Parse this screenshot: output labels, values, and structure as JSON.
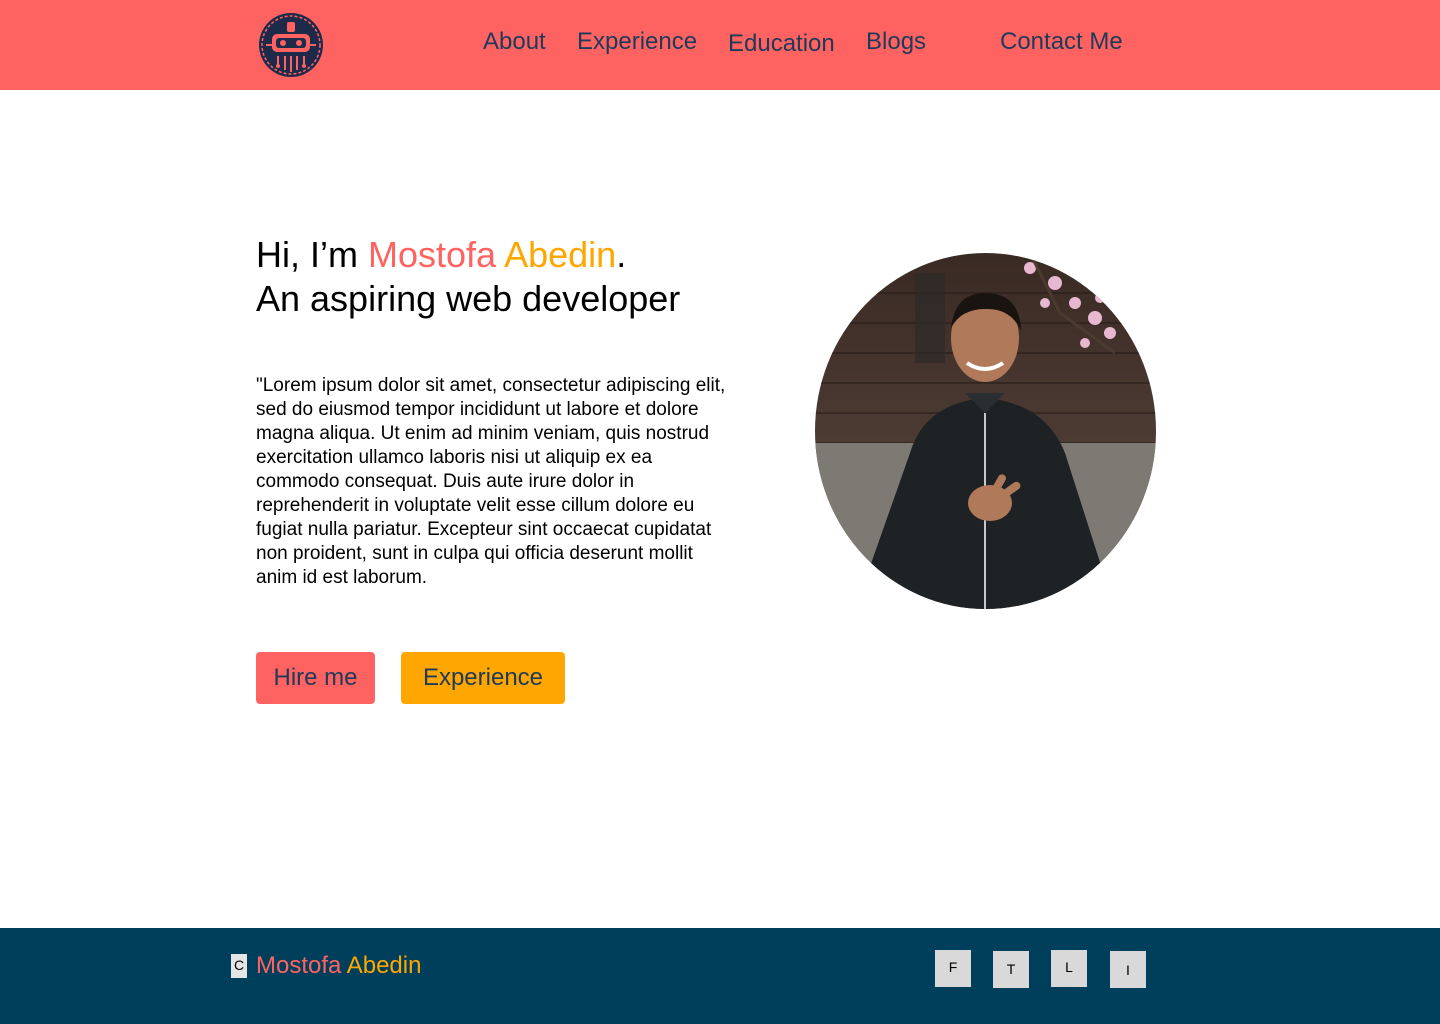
{
  "nav": {
    "about": "About",
    "experience": "Experience",
    "education": "Education",
    "blogs": "Blogs",
    "contact": "Contact Me"
  },
  "hero": {
    "greeting": "Hi, I’m ",
    "first_name": "Mostofa",
    "last_name": "Abedin",
    "period": ".",
    "tagline": "An aspiring web developer",
    "description": "\"Lorem ipsum dolor sit amet, consectetur adipiscing elit, sed do eiusmod tempor incididunt ut labore et dolore magna aliqua. Ut enim ad minim veniam, quis nostrud exercitation ullamco laboris nisi ut aliquip ex ea commodo consequat. Duis aute irure dolor in reprehenderit in voluptate velit esse cillum dolore eu fugiat nulla pariatur. Excepteur sint occaecat cupidatat non proident, sunt in culpa qui officia deserunt mollit anim id est laborum.",
    "hire_button": "Hire me",
    "experience_button": "Experience"
  },
  "footer": {
    "copyright_icon": "C",
    "first_name": "Mostofa",
    "last_name": "Abedin",
    "socials": [
      "F",
      "T",
      "L",
      "I"
    ]
  },
  "colors": {
    "header_bg": "#ff6361",
    "accent_orange": "#ffa600",
    "footer_bg": "#003f5c",
    "nav_text": "#1e3a5a"
  },
  "icons": {
    "logo": "circuit-robot-logo-icon",
    "profile_photo": "profile-photo"
  }
}
